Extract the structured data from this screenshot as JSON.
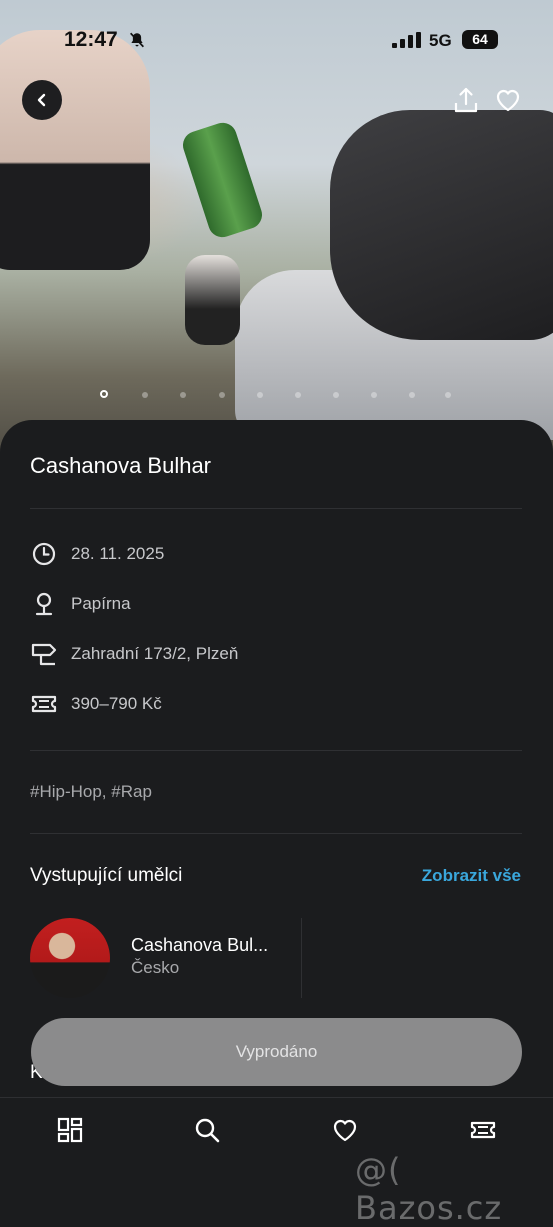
{
  "status_bar": {
    "time": "12:47",
    "network": "5G",
    "battery": "64"
  },
  "hero": {
    "carousel_count": 10,
    "active_index": 0
  },
  "event": {
    "title": "Cashanova Bulhar",
    "date": "28. 11. 2025",
    "venue": "Papírna",
    "address": "Zahradní 173/2, Plzeň",
    "price": "390–790 Kč",
    "tags": "#Hip-Hop, #Rap"
  },
  "artists_section": {
    "title": "Vystupující umělci",
    "see_all": "Zobrazit vše",
    "artists": [
      {
        "name": "Cashanova Bul...",
        "country": "Česko"
      }
    ]
  },
  "next_section_peek": "K",
  "cta": {
    "label": "Vyprodáno"
  },
  "watermark": "@( Bazos.cz",
  "icons": [
    "back-icon",
    "share-icon",
    "heart-icon",
    "clock-icon",
    "location-pin-icon",
    "signpost-icon",
    "ticket-icon",
    "dashboard-icon",
    "search-icon",
    "heart-icon",
    "ticket-icon"
  ]
}
